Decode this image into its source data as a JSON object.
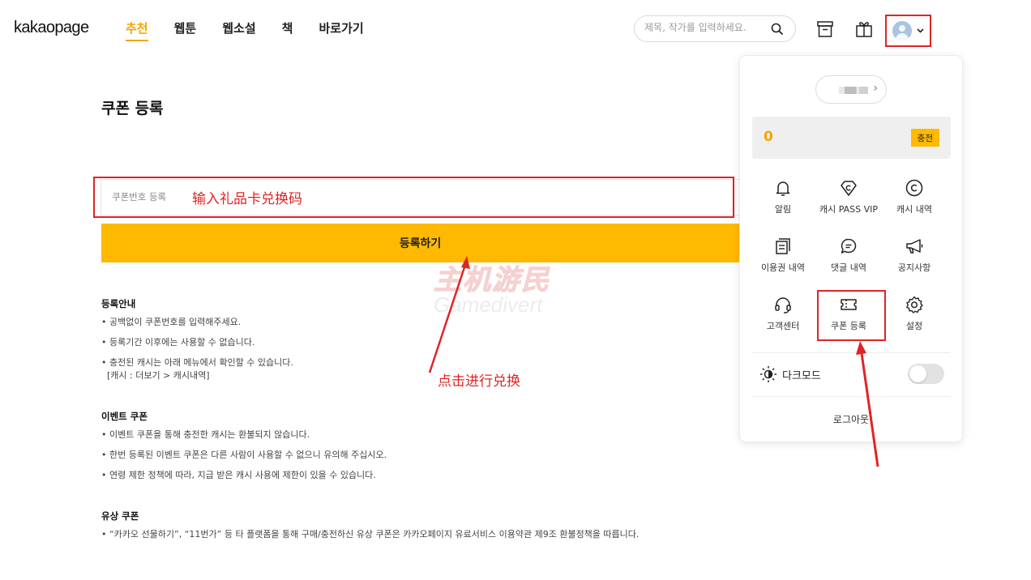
{
  "header": {
    "logo": "kakaopage",
    "nav": [
      {
        "label": "추천",
        "active": true
      },
      {
        "label": "웹툰",
        "active": false
      },
      {
        "label": "웹소설",
        "active": false
      },
      {
        "label": "책",
        "active": false
      },
      {
        "label": "바로가기",
        "active": false
      }
    ],
    "search_placeholder": "제목, 작가를 입력하세요.",
    "icons": [
      "search-icon",
      "storage-box-icon",
      "gift-icon",
      "avatar",
      "chevron-down-icon"
    ]
  },
  "main": {
    "title": "쿠폰 등록",
    "coupon_placeholder": "쿠폰번호 등록",
    "register_label": "등록하기",
    "sections": [
      {
        "title": "등록안내",
        "lines": [
          "• 공백없이 쿠폰번호를 입력해주세요.",
          "• 등록기간 이후에는 사용할 수 없습니다.",
          "• 충전된 캐시는 아래 메뉴에서 확인할 수 있습니다.",
          "[캐시 : 더보기 > 캐시내역]"
        ]
      },
      {
        "title": "이벤트 쿠폰",
        "lines": [
          "• 이벤트 쿠폰을 통해 충전한 캐시는 환불되지 않습니다.",
          "• 한번 등록된 이벤트 쿠폰은 다른 사람이 사용할 수 없으니 유의해 주십시오.",
          "• 연령 제한 정책에 따라, 지급 받은 캐시 사용에 제한이 있을 수 있습니다."
        ]
      },
      {
        "title": "유상 쿠폰",
        "lines": [
          "• “카카오 선물하기”, “11번가” 등 타 플랫폼을 통해 구매/충전하신 유상 쿠폰은 카카오페이지 유료서비스 이용약관 제9조 환불정책을 따릅니다."
        ]
      }
    ]
  },
  "annotations": {
    "input_hint": "输入礼品卡兑换码",
    "click_hint": "点击进行兑换",
    "color": "#e02424"
  },
  "watermark": {
    "top": "主机游民",
    "bottom": "Gamedivert"
  },
  "dropdown": {
    "cash_amount": "0",
    "charge_label": "충전",
    "menu": [
      {
        "label": "알림",
        "icon": "bell-icon"
      },
      {
        "label": "캐시 PASS VIP",
        "icon": "vip-diamond-icon"
      },
      {
        "label": "캐시 내역",
        "icon": "cash-circle-icon"
      },
      {
        "label": "이용권 내역",
        "icon": "ticket-list-icon"
      },
      {
        "label": "댓글 내역",
        "icon": "comment-icon"
      },
      {
        "label": "공지사항",
        "icon": "megaphone-icon"
      },
      {
        "label": "고객센터",
        "icon": "headset-icon"
      },
      {
        "label": "쿠폰 등록",
        "icon": "coupon-icon"
      },
      {
        "label": "설정",
        "icon": "gear-icon"
      }
    ],
    "dark_mode_label": "다크모드",
    "dark_mode_on": false,
    "logout_label": "로그아웃"
  },
  "colors": {
    "accent": "#ffb900",
    "accent_text": "#f5a400",
    "annotation": "#e02424"
  }
}
